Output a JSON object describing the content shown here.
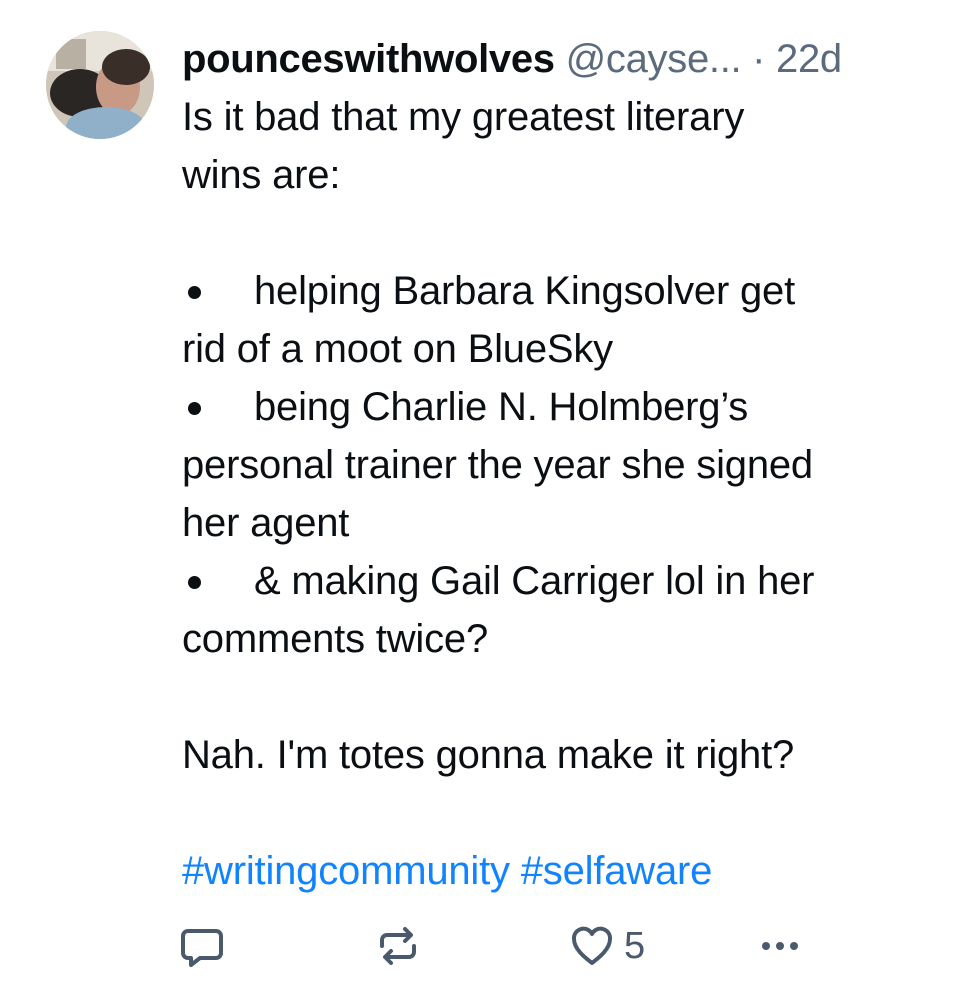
{
  "post": {
    "author": {
      "display_name": "pounceswithwolves",
      "handle": "@cayse...",
      "separator": "·",
      "timestamp": "22d"
    },
    "body": {
      "line1": "Is it bad that my greatest literary",
      "line2": "wins are:",
      "bullet1_line1": "helping Barbara Kingsolver get",
      "bullet1_line2": "rid of a moot on BlueSky",
      "bullet2_line1": "being Charlie N. Holmberg’s",
      "bullet2_line2": "personal trainer the year she signed",
      "bullet2_line3": "her agent",
      "bullet3_line1": "& making Gail Carriger lol in her",
      "bullet3_line2": "comments twice?",
      "closing": "Nah. I'm totes gonna make it right?"
    },
    "hashtags": [
      "#writingcommunity",
      "#selfaware"
    ],
    "actions": {
      "reply_icon": "reply-icon",
      "repost_icon": "repost-icon",
      "like_icon": "heart-icon",
      "like_count": "5",
      "more_icon": "more-icon"
    },
    "colors": {
      "text": "#0b0f14",
      "muted": "#5b6b7d",
      "link": "#1083fe",
      "icon": "#4a5a6c"
    }
  }
}
